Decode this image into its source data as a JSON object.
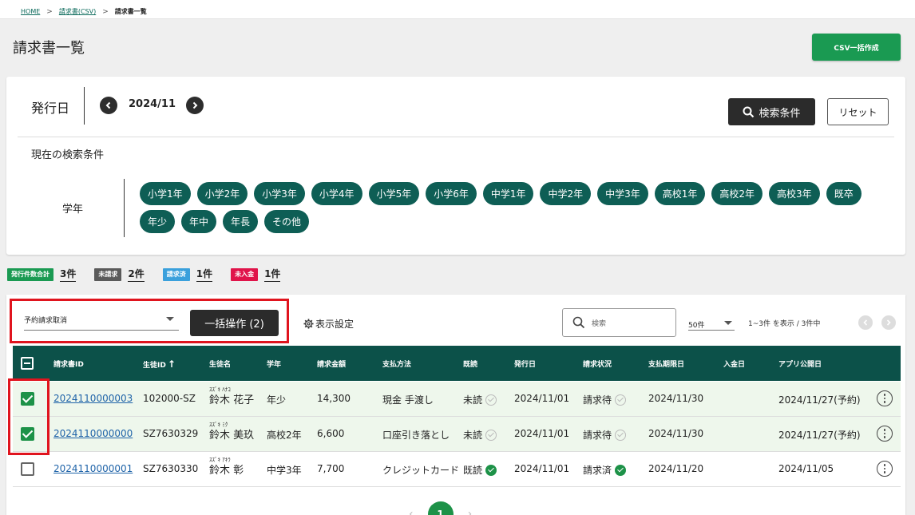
{
  "breadcrumb": {
    "home": "HOME",
    "invoice_csv": "請求書(CSV)",
    "current": "請求書一覧"
  },
  "page": {
    "title": "請求書一覧",
    "csv_button": "CSV一括作成"
  },
  "filter": {
    "issue_date_label": "発行日",
    "date_value": "2024/11",
    "search_button": "検索条件",
    "reset_button": "リセット",
    "current_conditions_label": "現在の検索条件",
    "grade_label": "学年",
    "grades": [
      "小学1年",
      "小学2年",
      "小学3年",
      "小学4年",
      "小学5年",
      "小学6年",
      "中学1年",
      "中学2年",
      "中学3年",
      "高校1年",
      "高校2年",
      "高校3年",
      "既卒",
      "年少",
      "年中",
      "年長",
      "その他"
    ]
  },
  "stats": [
    {
      "label": "発行件数合計",
      "count": "3件",
      "color": "#1a9a52"
    },
    {
      "label": "未請求",
      "count": "2件",
      "color": "#5a5a5a"
    },
    {
      "label": "請求済",
      "count": "1件",
      "color": "#3aa0dc"
    },
    {
      "label": "未入金",
      "count": "1件",
      "color": "#e0144a"
    }
  ],
  "toolbar": {
    "bulk_select_value": "予約請求取消",
    "bulk_button": "一括操作 (2)",
    "display_settings": "表示設定",
    "search_placeholder": "検索",
    "per_page": "50件",
    "range_text": "1~3件 を表示 / 3件中"
  },
  "table": {
    "headers": {
      "id": "請求書ID",
      "student_id": "生徒ID",
      "sort_arrow": "↑",
      "name": "生徒名",
      "grade": "学年",
      "amount": "請求金額",
      "payment": "支払方法",
      "read": "既読",
      "issued": "発行日",
      "status": "請求状況",
      "due": "支払期限日",
      "paid": "入金日",
      "app_date": "アプリ公開日"
    },
    "rows": [
      {
        "checked": true,
        "id": "2024110000003",
        "student_id": "102000-SZ",
        "kana": "ｽｽﾞｷ ﾊﾅｺ",
        "name": "鈴木 花子",
        "grade": "年少",
        "amount": "14,300",
        "payment": "現金 手渡し",
        "read": "未読",
        "read_done": false,
        "issued": "2024/11/01",
        "status": "請求待",
        "status_done": false,
        "due": "2024/11/30",
        "paid": "",
        "app_date": "2024/11/27(予約)"
      },
      {
        "checked": true,
        "id": "2024110000000",
        "student_id": "SZ7630329",
        "kana": "ｽｽﾞｷ ﾐｸ",
        "name": "鈴木 美玖",
        "grade": "高校2年",
        "amount": "6,600",
        "payment": "口座引き落とし",
        "read": "未読",
        "read_done": false,
        "issued": "2024/11/01",
        "status": "請求待",
        "status_done": false,
        "due": "2024/11/30",
        "paid": "",
        "app_date": "2024/11/27(予約)"
      },
      {
        "checked": false,
        "id": "2024110000001",
        "student_id": "SZ7630330",
        "kana": "ｽｽﾞｷ ｱｷﾗ",
        "name": "鈴木 彰",
        "grade": "中学3年",
        "amount": "7,700",
        "payment": "クレジットカード",
        "read": "既読",
        "read_done": true,
        "issued": "2024/11/01",
        "status": "請求済",
        "status_done": true,
        "due": "2024/11/20",
        "paid": "",
        "app_date": "2024/11/05"
      }
    ]
  },
  "pagination": {
    "prev": "‹",
    "current": "1",
    "next": "›"
  },
  "icons": {
    "prev_month": "chevron-left-icon",
    "next_month": "chevron-right-icon",
    "search": "search-icon",
    "gear": "gear-icon",
    "kebab": "more-vertical-icon",
    "check": "check-circle-icon"
  }
}
